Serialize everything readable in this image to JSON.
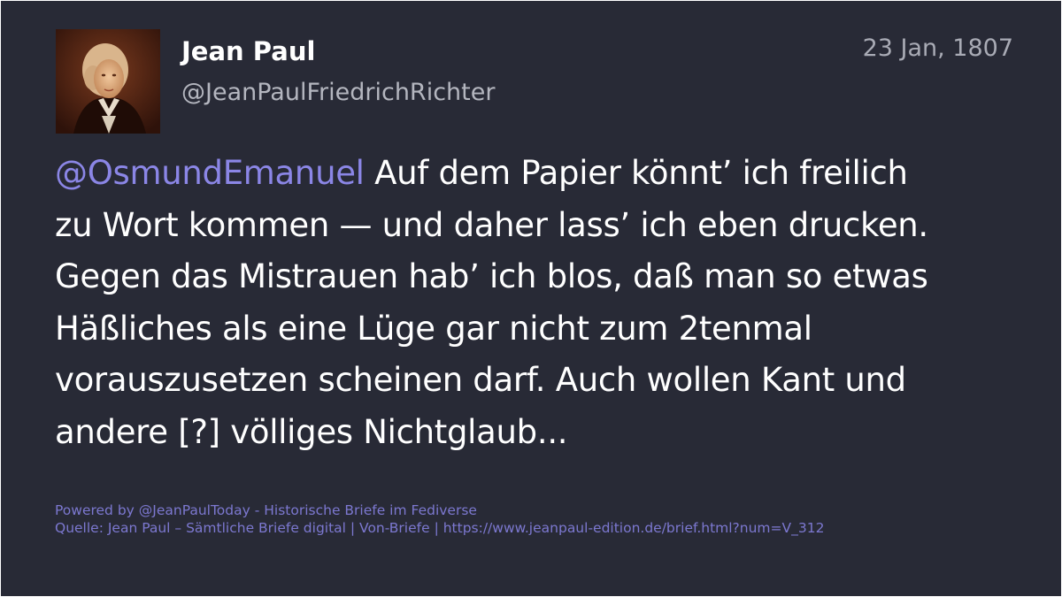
{
  "post": {
    "author": {
      "display_name": "Jean Paul",
      "handle": "@JeanPaulFriedrichRichter",
      "avatar_icon": "portrait-avatar"
    },
    "date": "23 Jan, 1807",
    "body": {
      "mention": "@OsmundEmanuel",
      "lines": [
        " Auf dem Papier könnt’ ich freilich",
        "zu Wort kommen — und daher lass’ ich eben drucken.",
        "Gegen das Mistrauen hab’ ich blos, daß man so etwas",
        "Häßliches als eine Lüge gar nicht zum 2tenmal",
        "vorauszusetzen scheinen darf. Auch wollen Kant und",
        "andere [?] völliges Nichtglaub..."
      ]
    }
  },
  "footer": {
    "powered_by": "Powered by @JeanPaulToday - Historische Briefe im Fediverse",
    "source": "Quelle: Jean Paul – Sämtliche Briefe digital | Von-Briefe | https://www.jeanpaul-edition.de/brief.html?num=V_312"
  },
  "colors": {
    "background": "#282a36",
    "text": "#ffffff",
    "muted": "#b4b6bf",
    "mention": "#8b86e6",
    "footer": "#7c78d0"
  }
}
